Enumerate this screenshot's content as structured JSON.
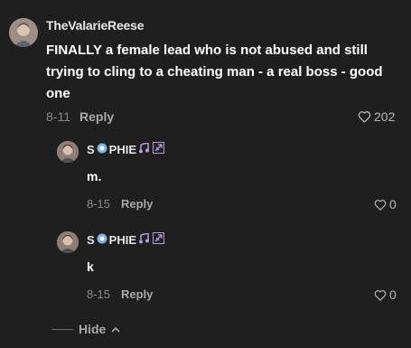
{
  "comments": [
    {
      "username": "TheValarieReese",
      "text_line1": "FINALLY a female lead who is not abused and still",
      "text_line2": "trying to cling to a cheating man - a real boss - good",
      "text_line3": "one",
      "date": "8-11",
      "reply_label": "Reply",
      "likes": "202"
    }
  ],
  "replies": [
    {
      "name_part1": "S",
      "name_part2": "PHIE",
      "text": "m.",
      "date": "8-15",
      "reply_label": "Reply",
      "likes": "0"
    },
    {
      "name_part1": "S",
      "name_part2": "PHIE",
      "text": "k",
      "date": "8-15",
      "reply_label": "Reply",
      "likes": "0"
    }
  ],
  "hide_label": "Hide",
  "colors": {
    "background": "#1f1f1f",
    "text": "#ffffff",
    "muted": "#8a8a8a"
  }
}
